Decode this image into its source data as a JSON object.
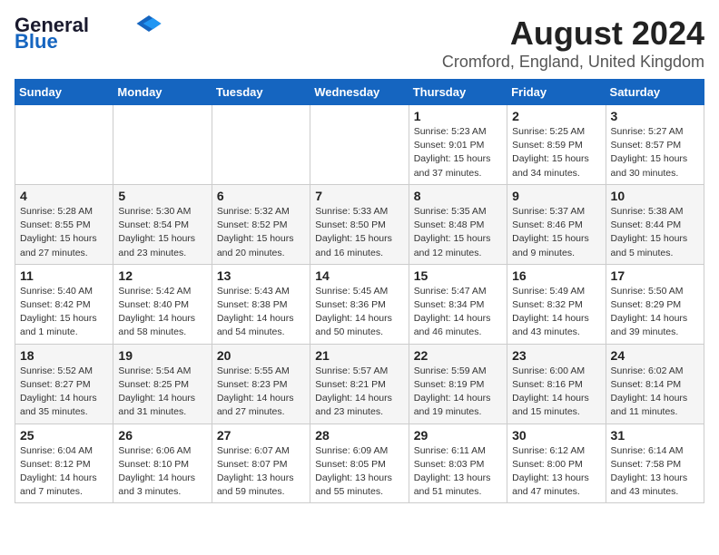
{
  "header": {
    "logo_line1": "General",
    "logo_line2": "Blue",
    "month_title": "August 2024",
    "location": "Cromford, England, United Kingdom"
  },
  "weekdays": [
    "Sunday",
    "Monday",
    "Tuesday",
    "Wednesday",
    "Thursday",
    "Friday",
    "Saturday"
  ],
  "weeks": [
    [
      {
        "day": "",
        "info": ""
      },
      {
        "day": "",
        "info": ""
      },
      {
        "day": "",
        "info": ""
      },
      {
        "day": "",
        "info": ""
      },
      {
        "day": "1",
        "info": "Sunrise: 5:23 AM\nSunset: 9:01 PM\nDaylight: 15 hours\nand 37 minutes."
      },
      {
        "day": "2",
        "info": "Sunrise: 5:25 AM\nSunset: 8:59 PM\nDaylight: 15 hours\nand 34 minutes."
      },
      {
        "day": "3",
        "info": "Sunrise: 5:27 AM\nSunset: 8:57 PM\nDaylight: 15 hours\nand 30 minutes."
      }
    ],
    [
      {
        "day": "4",
        "info": "Sunrise: 5:28 AM\nSunset: 8:55 PM\nDaylight: 15 hours\nand 27 minutes."
      },
      {
        "day": "5",
        "info": "Sunrise: 5:30 AM\nSunset: 8:54 PM\nDaylight: 15 hours\nand 23 minutes."
      },
      {
        "day": "6",
        "info": "Sunrise: 5:32 AM\nSunset: 8:52 PM\nDaylight: 15 hours\nand 20 minutes."
      },
      {
        "day": "7",
        "info": "Sunrise: 5:33 AM\nSunset: 8:50 PM\nDaylight: 15 hours\nand 16 minutes."
      },
      {
        "day": "8",
        "info": "Sunrise: 5:35 AM\nSunset: 8:48 PM\nDaylight: 15 hours\nand 12 minutes."
      },
      {
        "day": "9",
        "info": "Sunrise: 5:37 AM\nSunset: 8:46 PM\nDaylight: 15 hours\nand 9 minutes."
      },
      {
        "day": "10",
        "info": "Sunrise: 5:38 AM\nSunset: 8:44 PM\nDaylight: 15 hours\nand 5 minutes."
      }
    ],
    [
      {
        "day": "11",
        "info": "Sunrise: 5:40 AM\nSunset: 8:42 PM\nDaylight: 15 hours\nand 1 minute."
      },
      {
        "day": "12",
        "info": "Sunrise: 5:42 AM\nSunset: 8:40 PM\nDaylight: 14 hours\nand 58 minutes."
      },
      {
        "day": "13",
        "info": "Sunrise: 5:43 AM\nSunset: 8:38 PM\nDaylight: 14 hours\nand 54 minutes."
      },
      {
        "day": "14",
        "info": "Sunrise: 5:45 AM\nSunset: 8:36 PM\nDaylight: 14 hours\nand 50 minutes."
      },
      {
        "day": "15",
        "info": "Sunrise: 5:47 AM\nSunset: 8:34 PM\nDaylight: 14 hours\nand 46 minutes."
      },
      {
        "day": "16",
        "info": "Sunrise: 5:49 AM\nSunset: 8:32 PM\nDaylight: 14 hours\nand 43 minutes."
      },
      {
        "day": "17",
        "info": "Sunrise: 5:50 AM\nSunset: 8:29 PM\nDaylight: 14 hours\nand 39 minutes."
      }
    ],
    [
      {
        "day": "18",
        "info": "Sunrise: 5:52 AM\nSunset: 8:27 PM\nDaylight: 14 hours\nand 35 minutes."
      },
      {
        "day": "19",
        "info": "Sunrise: 5:54 AM\nSunset: 8:25 PM\nDaylight: 14 hours\nand 31 minutes."
      },
      {
        "day": "20",
        "info": "Sunrise: 5:55 AM\nSunset: 8:23 PM\nDaylight: 14 hours\nand 27 minutes."
      },
      {
        "day": "21",
        "info": "Sunrise: 5:57 AM\nSunset: 8:21 PM\nDaylight: 14 hours\nand 23 minutes."
      },
      {
        "day": "22",
        "info": "Sunrise: 5:59 AM\nSunset: 8:19 PM\nDaylight: 14 hours\nand 19 minutes."
      },
      {
        "day": "23",
        "info": "Sunrise: 6:00 AM\nSunset: 8:16 PM\nDaylight: 14 hours\nand 15 minutes."
      },
      {
        "day": "24",
        "info": "Sunrise: 6:02 AM\nSunset: 8:14 PM\nDaylight: 14 hours\nand 11 minutes."
      }
    ],
    [
      {
        "day": "25",
        "info": "Sunrise: 6:04 AM\nSunset: 8:12 PM\nDaylight: 14 hours\nand 7 minutes."
      },
      {
        "day": "26",
        "info": "Sunrise: 6:06 AM\nSunset: 8:10 PM\nDaylight: 14 hours\nand 3 minutes."
      },
      {
        "day": "27",
        "info": "Sunrise: 6:07 AM\nSunset: 8:07 PM\nDaylight: 13 hours\nand 59 minutes."
      },
      {
        "day": "28",
        "info": "Sunrise: 6:09 AM\nSunset: 8:05 PM\nDaylight: 13 hours\nand 55 minutes."
      },
      {
        "day": "29",
        "info": "Sunrise: 6:11 AM\nSunset: 8:03 PM\nDaylight: 13 hours\nand 51 minutes."
      },
      {
        "day": "30",
        "info": "Sunrise: 6:12 AM\nSunset: 8:00 PM\nDaylight: 13 hours\nand 47 minutes."
      },
      {
        "day": "31",
        "info": "Sunrise: 6:14 AM\nSunset: 7:58 PM\nDaylight: 13 hours\nand 43 minutes."
      }
    ]
  ]
}
